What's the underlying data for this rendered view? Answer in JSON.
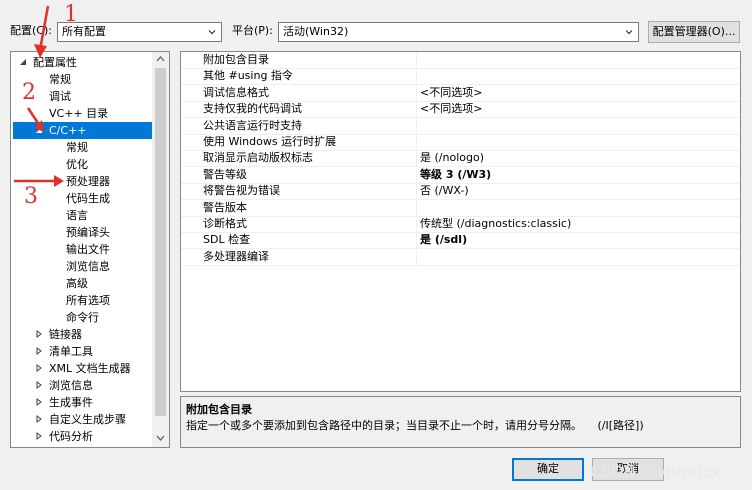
{
  "toolbar": {
    "config_label": "配置(C):",
    "config_value": "所有配置",
    "platform_label": "平台(P):",
    "platform_value": "活动(Win32)",
    "config_manager_button": "配置管理器(O)..."
  },
  "tree": {
    "items": [
      {
        "label": "配置属性",
        "expander": "expanded"
      },
      {
        "label": "常规"
      },
      {
        "label": "调试"
      },
      {
        "label": "VC++ 目录"
      },
      {
        "label": "C/C++",
        "expander": "expanded",
        "selected": true
      },
      {
        "label": "常规"
      },
      {
        "label": "优化"
      },
      {
        "label": "预处理器"
      },
      {
        "label": "代码生成"
      },
      {
        "label": "语言"
      },
      {
        "label": "预编译头"
      },
      {
        "label": "输出文件"
      },
      {
        "label": "浏览信息"
      },
      {
        "label": "高级"
      },
      {
        "label": "所有选项"
      },
      {
        "label": "命令行"
      },
      {
        "label": "链接器",
        "expander": "collapsed"
      },
      {
        "label": "清单工具",
        "expander": "collapsed"
      },
      {
        "label": "XML 文档生成器",
        "expander": "collapsed"
      },
      {
        "label": "浏览信息",
        "expander": "collapsed"
      },
      {
        "label": "生成事件",
        "expander": "collapsed"
      },
      {
        "label": "自定义生成步骤",
        "expander": "collapsed"
      },
      {
        "label": "代码分析",
        "expander": "collapsed"
      }
    ]
  },
  "properties": {
    "rows": [
      {
        "name": "附加包含目录",
        "value": ""
      },
      {
        "name": "其他 #using 指令",
        "value": ""
      },
      {
        "name": "调试信息格式",
        "value": "<不同选项>"
      },
      {
        "name": "支持仅我的代码调试",
        "value": "<不同选项>"
      },
      {
        "name": "公共语言运行时支持",
        "value": ""
      },
      {
        "name": "使用 Windows 运行时扩展",
        "value": ""
      },
      {
        "name": "取消显示启动版权标志",
        "value": "是 (/nologo)"
      },
      {
        "name": "警告等级",
        "value": "等级 3 (/W3)",
        "bold": true
      },
      {
        "name": "将警告视为错误",
        "value": "否 (/WX-)"
      },
      {
        "name": "警告版本",
        "value": ""
      },
      {
        "name": "诊断格式",
        "value": "传统型 (/diagnostics:classic)"
      },
      {
        "name": "SDL 检查",
        "value": "是 (/sdl)",
        "bold": true
      },
      {
        "name": "多处理器编译",
        "value": ""
      }
    ]
  },
  "description": {
    "title": "附加包含目录",
    "text": "指定一个或多个要添加到包含路径中的目录；当目录不止一个时，请用分号分隔。",
    "switch": "(/I[路径])"
  },
  "footer": {
    "ok_button": "确定",
    "cancel_button": "取消"
  },
  "annotations": {
    "n1": "1",
    "n2": "2",
    "n3": "3"
  },
  "watermarks": {
    "csdn": "CSDN @vbnetcx"
  },
  "colors": {
    "selection": "#0078d7",
    "annotation": "#e0302a"
  }
}
